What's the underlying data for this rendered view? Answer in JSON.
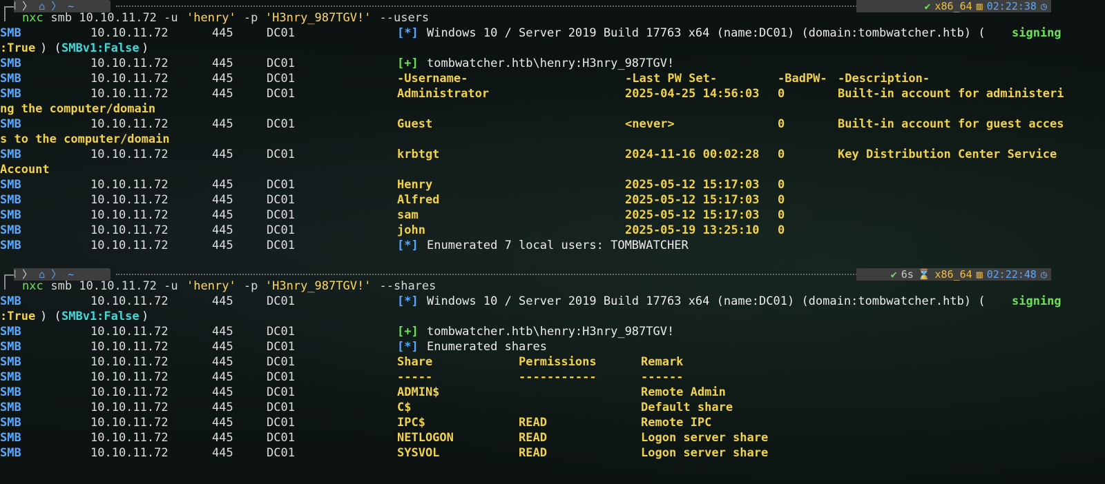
{
  "prompt1": {
    "status": "✔",
    "duration": "",
    "arch": "x86_64",
    "time": "02:22:38",
    "cmd": "nxc",
    "args": "smb 10.10.11.72 -u",
    "user": "'henry'",
    "pflag": "-p",
    "pass": "'H3nry_987TGV!'",
    "opt": "--users"
  },
  "prompt2": {
    "status": "✔",
    "duration": "6s",
    "arch": "x86_64",
    "time": "02:22:48",
    "cmd": "nxc",
    "args": "smb 10.10.11.72 -u",
    "user": "'henry'",
    "pflag": "-p",
    "pass": "'H3nry_987TGV!'",
    "opt": "--shares"
  },
  "proto": "SMB",
  "ip": "10.10.11.72",
  "port": "445",
  "name": "DC01",
  "info": {
    "mark": "[*]",
    "text": "Windows 10 / Server 2019 Build 17763 x64 (name:DC01) (domain:tombwatcher.htb) (",
    "signing": "signing",
    "cont": ":True",
    "smbv1": "SMBv1:False"
  },
  "auth": {
    "mark": "[+]",
    "text": "tombwatcher.htb\\henry:H3nry_987TGV!"
  },
  "users": {
    "headers": [
      "-Username-",
      "-Last PW Set-",
      "-BadPW-",
      "-Description-"
    ],
    "rows": [
      {
        "u": "Administrator",
        "t": "2025-04-25 14:56:03",
        "b": "0",
        "d": "Built-in account for administeri",
        "wrap": "ng the computer/domain"
      },
      {
        "u": "Guest",
        "t": "<never>",
        "b": "0",
        "d": "Built-in account for guest acces",
        "wrap": "s to the computer/domain"
      },
      {
        "u": "krbtgt",
        "t": "2024-11-16 00:02:28",
        "b": "0",
        "d": "Key Distribution Center Service",
        "wrap": "Account"
      },
      {
        "u": "Henry",
        "t": "2025-05-12 15:17:03",
        "b": "0",
        "d": "",
        "wrap": ""
      },
      {
        "u": "Alfred",
        "t": "2025-05-12 15:17:03",
        "b": "0",
        "d": "",
        "wrap": ""
      },
      {
        "u": "sam",
        "t": "2025-05-12 15:17:03",
        "b": "0",
        "d": "",
        "wrap": ""
      },
      {
        "u": "john",
        "t": "2025-05-19 13:25:10",
        "b": "0",
        "d": "",
        "wrap": ""
      }
    ],
    "summary_mark": "[*]",
    "summary": "Enumerated 7 local users: TOMBWATCHER"
  },
  "shares": {
    "enum_mark": "[*]",
    "enum": "Enumerated shares",
    "headers": [
      "Share",
      "Permissions",
      "Remark"
    ],
    "dashes": [
      "-----",
      "-----------",
      "------"
    ],
    "rows": [
      {
        "s": "ADMIN$",
        "p": "",
        "r": "Remote Admin"
      },
      {
        "s": "C$",
        "p": "",
        "r": "Default share"
      },
      {
        "s": "IPC$",
        "p": "READ",
        "r": "Remote IPC"
      },
      {
        "s": "NETLOGON",
        "p": "READ",
        "r": "Logon server share"
      },
      {
        "s": "SYSVOL",
        "p": "READ",
        "r": "Logon server share"
      }
    ]
  },
  "colors": {
    "smb": "#5aa9ff",
    "yellow": "#f2d24b",
    "cyan": "#47d7d7",
    "green": "#6ee05a"
  }
}
